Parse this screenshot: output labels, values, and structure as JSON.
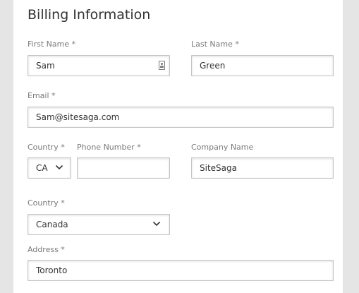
{
  "form": {
    "title": "Billing Information",
    "first_name": {
      "label": "First Name *",
      "value": "Sam",
      "icon": "contact-card-icon"
    },
    "last_name": {
      "label": "Last Name *",
      "value": "Green"
    },
    "email": {
      "label": "Email *",
      "value": "Sam@sitesaga.com"
    },
    "country_code": {
      "label": "Country *",
      "value": "CA",
      "icon": "chevron-down-icon"
    },
    "phone": {
      "label": "Phone Number *",
      "value": ""
    },
    "company": {
      "label": "Company Name",
      "value": "SiteSaga"
    },
    "country": {
      "label": "Country *",
      "value": "Canada",
      "icon": "chevron-down-icon"
    },
    "address": {
      "label": "Address *",
      "value": "Toronto"
    }
  },
  "colors": {
    "page_background": "#e5e5e5",
    "card_background": "#ffffff",
    "label_text": "#7a7a7a",
    "input_text": "#333333",
    "input_border": "#c4c4c4"
  }
}
